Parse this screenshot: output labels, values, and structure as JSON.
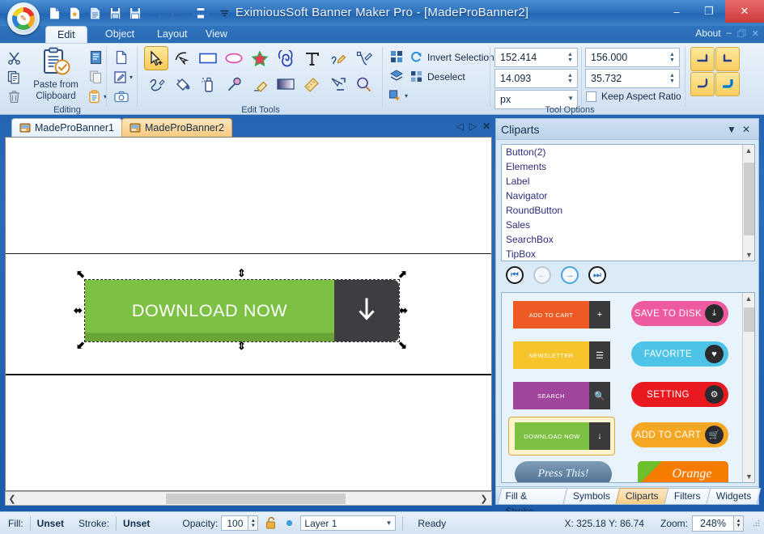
{
  "window": {
    "title": "EximiousSoft Banner Maker Pro - [MadeProBanner2]",
    "minimize": "–",
    "maximize": "❐",
    "close": "✕"
  },
  "quick_access": [
    {
      "name": "new-document-icon",
      "label": "New"
    },
    {
      "name": "open-favorite-icon",
      "label": "Open Template"
    },
    {
      "name": "open-document-icon",
      "label": "Open"
    },
    {
      "name": "save-icon",
      "label": "Save"
    },
    {
      "name": "save-as-icon",
      "label": "Save As"
    },
    {
      "name": "undo-icon",
      "label": "Undo"
    },
    {
      "name": "redo-icon",
      "label": "Redo"
    },
    {
      "name": "print-icon",
      "label": "Print"
    },
    {
      "name": "customize-qat-icon",
      "label": "Customize"
    }
  ],
  "ribbon": {
    "tabs": [
      {
        "label": "Edit",
        "active": true
      },
      {
        "label": "Object",
        "active": false
      },
      {
        "label": "Layout",
        "active": false
      },
      {
        "label": "View",
        "active": false
      }
    ],
    "about_label": "About",
    "about_minimize": "–",
    "about_restore": "❐",
    "about_close": "✕",
    "groups": {
      "editing": {
        "label": "Editing",
        "paste_label_line1": "Paste from",
        "paste_label_line2": "Clipboard",
        "buttons": [
          {
            "name": "cut-icon",
            "label": "Cut"
          },
          {
            "name": "copy-icon",
            "label": "Copy"
          },
          {
            "name": "delete-icon",
            "label": "Delete"
          },
          {
            "name": "paste-special-icon",
            "label": "Paste Special"
          },
          {
            "name": "copy-image-icon",
            "label": "Copy Image"
          },
          {
            "name": "clipboard-dropdown-icon",
            "label": "Clipboard Options"
          },
          {
            "name": "duplicate-icon",
            "label": "Duplicate"
          },
          {
            "name": "edit-image-icon",
            "label": "Edit Image"
          },
          {
            "name": "capture-icon",
            "label": "Screen Capture"
          }
        ]
      },
      "edit_tools": {
        "label": "Edit Tools",
        "tools_row1": [
          {
            "name": "select-tool",
            "label": "Select",
            "selected": true
          },
          {
            "name": "node-edit-tool",
            "label": "Node Edit",
            "selected": false
          },
          {
            "name": "rectangle-tool",
            "label": "Rectangle",
            "selected": false
          },
          {
            "name": "ellipse-tool",
            "label": "Ellipse",
            "selected": false
          },
          {
            "name": "star-tool",
            "label": "Star",
            "selected": false
          },
          {
            "name": "spiral-tool",
            "label": "Spiral",
            "selected": false
          },
          {
            "name": "text-tool",
            "label": "Text",
            "selected": false
          },
          {
            "name": "pencil-tool",
            "label": "Pencil",
            "selected": false
          },
          {
            "name": "bezier-tool",
            "label": "Bezier",
            "selected": false
          }
        ],
        "tools_row2": [
          {
            "name": "calligraphy-tool",
            "label": "Calligraphy",
            "selected": false
          },
          {
            "name": "paint-bucket-tool",
            "label": "Paint Bucket",
            "selected": false
          },
          {
            "name": "spray-tool",
            "label": "Spray",
            "selected": false
          },
          {
            "name": "eyedropper-tool",
            "label": "Eyedropper",
            "selected": false
          },
          {
            "name": "eraser-tool",
            "label": "Eraser",
            "selected": false
          },
          {
            "name": "gradient-tool",
            "label": "Gradient",
            "selected": false
          },
          {
            "name": "measure-tool",
            "label": "Measure",
            "selected": false
          },
          {
            "name": "connector-tool",
            "label": "Connector",
            "selected": false
          },
          {
            "name": "zoom-tool",
            "label": "Zoom",
            "selected": false
          }
        ]
      },
      "tool_options": {
        "label": "Tool Options",
        "select_all_label": "Select All",
        "select_same_label": "Select Same",
        "select_dropdown_label": "Selection Options",
        "invert_selection_label": "Invert Selection",
        "deselect_label": "Deselect",
        "x_value": "152.414",
        "y_value": "14.093",
        "width_value": "156.000",
        "height_value": "35.732",
        "unit_value": "px",
        "keep_aspect_label": "Keep Aspect Ratio",
        "keep_aspect_checked": false,
        "align_buttons": [
          {
            "name": "rotate-left-button",
            "label": "Rotate Left"
          },
          {
            "name": "rotate-right-button",
            "label": "Rotate Right"
          },
          {
            "name": "flip-horizontal-button",
            "label": "Flip Horizontal"
          },
          {
            "name": "flip-vertical-button",
            "label": "Flip Vertical"
          }
        ]
      }
    }
  },
  "document_tabs": {
    "tabs": [
      {
        "label": "MadeProBanner1",
        "active": false
      },
      {
        "label": "MadeProBanner2",
        "active": true
      }
    ],
    "nav_prev": "◁",
    "nav_next": "▷",
    "nav_close": "✕"
  },
  "canvas": {
    "selected_object": {
      "text": "DOWNLOAD NOW",
      "icon": "down-arrow-icon",
      "green_color": "#7cc143",
      "dark_color": "#3e3e42"
    },
    "hscroll_left": "❮",
    "hscroll_right": "❯"
  },
  "right_panel": {
    "title": "Cliparts",
    "collapse_icon": "▼",
    "close_icon": "✕",
    "categories": [
      "Button(2)",
      "Elements",
      "Label",
      "Navigator",
      "RoundButton",
      "Sales",
      "SearchBox",
      "TipBox"
    ],
    "nav_buttons": [
      {
        "name": "first-page-button",
        "glyph": "⏮",
        "state": "enabled"
      },
      {
        "name": "previous-page-button",
        "glyph": "←",
        "state": "disabled"
      },
      {
        "name": "next-page-button",
        "glyph": "→",
        "state": "enabled"
      },
      {
        "name": "last-page-button",
        "glyph": "⏭",
        "state": "enabled"
      }
    ],
    "cliparts": [
      {
        "label": "ADD TO CART",
        "style": "split",
        "color": "#ee5a24",
        "icon": "plus-icon",
        "selected": false
      },
      {
        "label": "SAVE TO DISK",
        "style": "pill",
        "color": "#ee5a9f",
        "icon": "download-icon",
        "selected": false
      },
      {
        "label": "NEWSLETTER",
        "style": "split",
        "color": "#f7c52b",
        "icon": "list-icon",
        "selected": false
      },
      {
        "label": "FAVORITE",
        "style": "pill",
        "color": "#4ec3e8",
        "icon": "heart-icon",
        "selected": false
      },
      {
        "label": "SEARCH",
        "style": "split",
        "color": "#a martyr",
        "icon": "search-icon",
        "selected": false
      },
      {
        "label": "SETTING",
        "style": "pill",
        "color": "#e8191f",
        "icon": "gear-icon",
        "selected": false
      },
      {
        "label": "DOWNLOAD NOW",
        "style": "split",
        "color": "#7cc143",
        "icon": "down-arrow-icon",
        "selected": true
      },
      {
        "label": "ADD TO CART",
        "style": "pill",
        "color": "#f5a623",
        "icon": "basket-icon",
        "selected": false
      },
      {
        "label": "Press This!",
        "style": "script",
        "color": "#5b7fa0",
        "icon": "",
        "selected": false
      },
      {
        "label": "Orange",
        "style": "ribbon",
        "color": "#f57c00",
        "icon": "fresh-ribbon",
        "selected": false
      }
    ],
    "clipart_search_color": "#a0459b",
    "bottom_tabs": [
      {
        "label": "Fill & Stroke",
        "active": false
      },
      {
        "label": "Symbols",
        "active": false
      },
      {
        "label": "Cliparts",
        "active": true
      },
      {
        "label": "Filters",
        "active": false
      },
      {
        "label": "Widgets",
        "active": false
      }
    ]
  },
  "status_bar": {
    "fill_label": "Fill:",
    "fill_value": "Unset",
    "stroke_label": "Stroke:",
    "stroke_value": "Unset",
    "opacity_label": "Opacity:",
    "opacity_value": "100",
    "lock_icon": "unlock-icon",
    "visibility_icon": "visible-icon",
    "layer_value": "Layer 1",
    "ready_text": "Ready",
    "coords_text": "X: 325.18 Y:  86.74",
    "zoom_label": "Zoom:",
    "zoom_value": "248%"
  }
}
